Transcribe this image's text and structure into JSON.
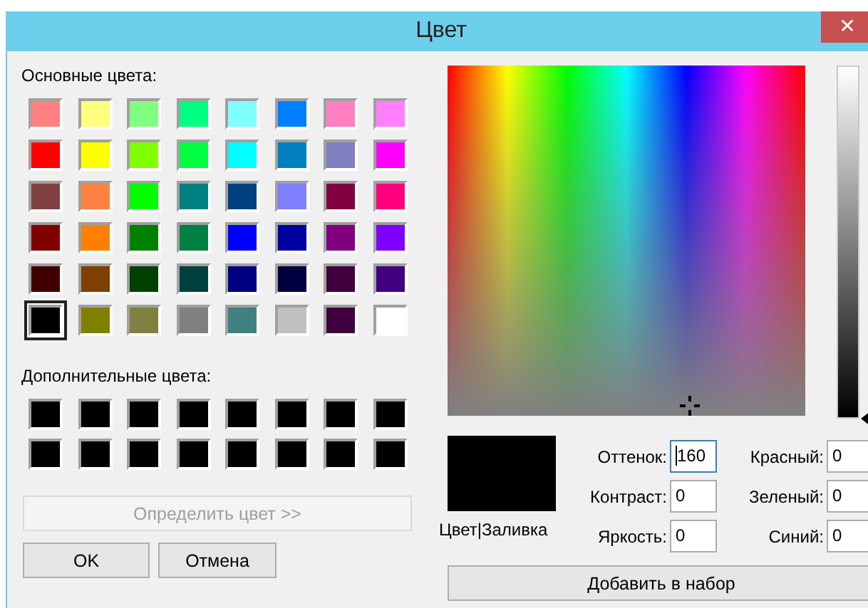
{
  "window": {
    "title": "Цвет",
    "close": "✕"
  },
  "basic_colors": {
    "label": "Основные цвета:",
    "swatches": [
      {
        "color": "#ff8080",
        "selected": false
      },
      {
        "color": "#ffff80",
        "selected": false
      },
      {
        "color": "#80ff80",
        "selected": false
      },
      {
        "color": "#00ff80",
        "selected": false
      },
      {
        "color": "#80ffff",
        "selected": false
      },
      {
        "color": "#0080ff",
        "selected": false
      },
      {
        "color": "#ff80c0",
        "selected": false
      },
      {
        "color": "#ff80ff",
        "selected": false
      },
      {
        "color": "#ff0000",
        "selected": false
      },
      {
        "color": "#ffff00",
        "selected": false
      },
      {
        "color": "#80ff00",
        "selected": false
      },
      {
        "color": "#00ff40",
        "selected": false
      },
      {
        "color": "#00ffff",
        "selected": false
      },
      {
        "color": "#0080c0",
        "selected": false
      },
      {
        "color": "#8080c0",
        "selected": false
      },
      {
        "color": "#ff00ff",
        "selected": false
      },
      {
        "color": "#804040",
        "selected": false
      },
      {
        "color": "#ff8040",
        "selected": false
      },
      {
        "color": "#00ff00",
        "selected": false
      },
      {
        "color": "#008080",
        "selected": false
      },
      {
        "color": "#004080",
        "selected": false
      },
      {
        "color": "#8080ff",
        "selected": false
      },
      {
        "color": "#800040",
        "selected": false
      },
      {
        "color": "#ff0080",
        "selected": false
      },
      {
        "color": "#800000",
        "selected": false
      },
      {
        "color": "#ff8000",
        "selected": false
      },
      {
        "color": "#008000",
        "selected": false
      },
      {
        "color": "#008040",
        "selected": false
      },
      {
        "color": "#0000ff",
        "selected": false
      },
      {
        "color": "#0000a0",
        "selected": false
      },
      {
        "color": "#800080",
        "selected": false
      },
      {
        "color": "#8000ff",
        "selected": false
      },
      {
        "color": "#400000",
        "selected": false
      },
      {
        "color": "#804000",
        "selected": false
      },
      {
        "color": "#004000",
        "selected": false
      },
      {
        "color": "#004040",
        "selected": false
      },
      {
        "color": "#000080",
        "selected": false
      },
      {
        "color": "#000040",
        "selected": false
      },
      {
        "color": "#400040",
        "selected": false
      },
      {
        "color": "#400080",
        "selected": false
      },
      {
        "color": "#000000",
        "selected": true
      },
      {
        "color": "#808000",
        "selected": false
      },
      {
        "color": "#808040",
        "selected": false
      },
      {
        "color": "#808080",
        "selected": false
      },
      {
        "color": "#408080",
        "selected": false
      },
      {
        "color": "#c0c0c0",
        "selected": false
      },
      {
        "color": "#400040",
        "selected": false
      },
      {
        "color": "#ffffff",
        "selected": false
      }
    ]
  },
  "custom_colors": {
    "label": "Дополнительные цвета:",
    "swatches": [
      {
        "color": "#000000"
      },
      {
        "color": "#000000"
      },
      {
        "color": "#000000"
      },
      {
        "color": "#000000"
      },
      {
        "color": "#000000"
      },
      {
        "color": "#000000"
      },
      {
        "color": "#000000"
      },
      {
        "color": "#000000"
      },
      {
        "color": "#000000"
      },
      {
        "color": "#000000"
      },
      {
        "color": "#000000"
      },
      {
        "color": "#000000"
      },
      {
        "color": "#000000"
      },
      {
        "color": "#000000"
      },
      {
        "color": "#000000"
      },
      {
        "color": "#000000"
      }
    ]
  },
  "define_button": {
    "label": "Определить цвет >>",
    "disabled": true
  },
  "ok_button": "OK",
  "cancel_button": "Отмена",
  "luminance_slider": {
    "level": 0
  },
  "preview": {
    "color": "#000000",
    "label": "Цвет|Заливка"
  },
  "fields": [
    {
      "label": "Оттенок:",
      "value": "160",
      "focused": true
    },
    {
      "label": "Красный:",
      "value": "0",
      "focused": false
    },
    {
      "label": "Контраст:",
      "value": "0",
      "focused": false
    },
    {
      "label": "Зеленый:",
      "value": "0",
      "focused": false
    },
    {
      "label": "Яркость:",
      "value": "0",
      "focused": false
    },
    {
      "label": "Синий:",
      "value": "0",
      "focused": false
    }
  ],
  "add_button": "Добавить в набор"
}
